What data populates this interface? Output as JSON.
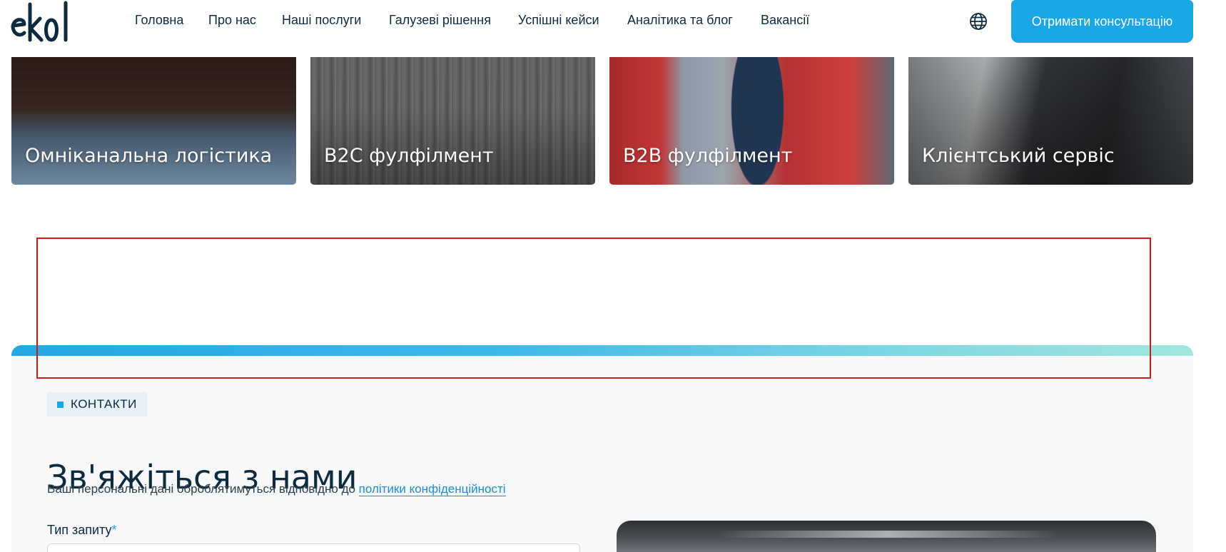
{
  "brand": {
    "logo_text": "ekol",
    "logo_color": "#0d2b3e"
  },
  "nav": {
    "items": [
      {
        "label": "Головна"
      },
      {
        "label": "Про нас"
      },
      {
        "label": "Наші послуги"
      },
      {
        "label": "Галузеві рішення"
      },
      {
        "label": "Успішні кейси"
      },
      {
        "label": "Аналітика та блог"
      },
      {
        "label": "Вакансії"
      }
    ],
    "language_icon": "globe-icon",
    "cta_label": "Отримати консультацію",
    "cta_color": "#1aa7e8"
  },
  "services": {
    "cards": [
      {
        "label": "Омніканальна логістика"
      },
      {
        "label": "B2C фулфілмент"
      },
      {
        "label": "B2B фулфілмент"
      },
      {
        "label": "Клієнтський сервіс"
      }
    ]
  },
  "highlight": {
    "color": "#d0181f"
  },
  "contact": {
    "tag": "КОНТАКТИ",
    "title": "Зв'яжіться з нами",
    "privacy_prefix": "Ваші персональні дані оброблятимуться відповідно до ",
    "privacy_link": "політики конфіденційності",
    "request_type_label": "Тип запиту",
    "required_mark": "*",
    "accent_color": "#1aa7e8"
  }
}
